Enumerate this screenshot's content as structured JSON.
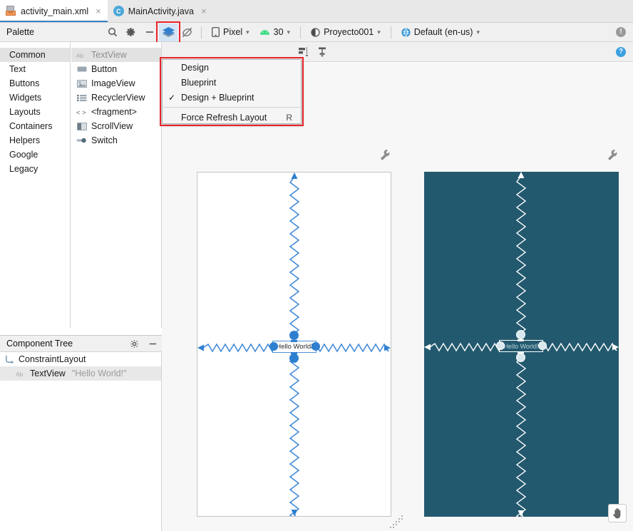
{
  "tabs": [
    {
      "label": "activity_main.xml",
      "icon": "xml-file-icon",
      "active": true,
      "close": "×"
    },
    {
      "label": "MainActivity.java",
      "icon": "java-class-icon",
      "active": false,
      "close": "×"
    }
  ],
  "palette": {
    "title": "Palette",
    "search_icon": "search-icon",
    "settings_icon": "gear-icon",
    "minimize_icon": "minimize-icon",
    "categories": [
      {
        "label": "Common",
        "selected": true
      },
      {
        "label": "Text",
        "selected": false
      },
      {
        "label": "Buttons",
        "selected": false
      },
      {
        "label": "Widgets",
        "selected": false
      },
      {
        "label": "Layouts",
        "selected": false
      },
      {
        "label": "Containers",
        "selected": false
      },
      {
        "label": "Helpers",
        "selected": false
      },
      {
        "label": "Google",
        "selected": false
      },
      {
        "label": "Legacy",
        "selected": false
      }
    ],
    "items": [
      {
        "label": "TextView",
        "icon": "textview-icon",
        "selected": true
      },
      {
        "label": "Button",
        "icon": "button-icon",
        "selected": false
      },
      {
        "label": "ImageView",
        "icon": "imageview-icon",
        "selected": false
      },
      {
        "label": "RecyclerView",
        "icon": "recyclerview-icon",
        "selected": false
      },
      {
        "label": "<fragment>",
        "icon": "fragment-icon",
        "selected": false
      },
      {
        "label": "ScrollView",
        "icon": "scrollview-icon",
        "selected": false
      },
      {
        "label": "Switch",
        "icon": "switch-icon",
        "selected": false
      }
    ]
  },
  "toolbar": {
    "minimize_label": "—",
    "layers_icon": "design-surface-layers-icon",
    "blueprint_off_icon": "blueprint-toggle-icon",
    "device_label": "Pixel",
    "device_icon": "phone-icon",
    "api_label": "30",
    "api_icon": "android-icon",
    "theme_label": "Proyecto001",
    "theme_icon": "theme-icon",
    "locale_label": "Default (en-us)",
    "locale_icon": "globe-icon",
    "warning_badge": "!",
    "help_badge": "?",
    "align_icon": "align-horizontal-icon",
    "baseline_icon": "baseline-align-icon"
  },
  "menu": {
    "items": [
      {
        "label": "Design",
        "checked": false,
        "accel": ""
      },
      {
        "label": "Blueprint",
        "checked": false,
        "accel": ""
      },
      {
        "label": "Design + Blueprint",
        "checked": true,
        "accel": ""
      }
    ],
    "footer": {
      "label": "Force Refresh Layout",
      "checked": false,
      "accel": "R"
    },
    "check_glyph": "✓",
    "highlight_color": "#e8232a"
  },
  "component_tree": {
    "title": "Component Tree",
    "settings_icon": "gear-icon",
    "minimize_icon": "minimize-icon",
    "rows": [
      {
        "label": "ConstraintLayout",
        "sub": "",
        "icon": "constraintlayout-icon",
        "selected": false
      },
      {
        "label": "TextView",
        "sub": "\"Hello World!\"",
        "icon": "textview-icon",
        "selected": true
      }
    ]
  },
  "canvas": {
    "design_text": "Hello World!",
    "blueprint_text": "Hello World!",
    "wrench_icon": "device-config-wrench-icon",
    "pan_icon": "pan-hand-icon",
    "resize_icon": "resize-grip-icon",
    "blueprint_color": "#23596e",
    "constraint_color": "#2f7fd0",
    "surface_color": "#ffffff",
    "background_color": "#f7f7f7"
  }
}
